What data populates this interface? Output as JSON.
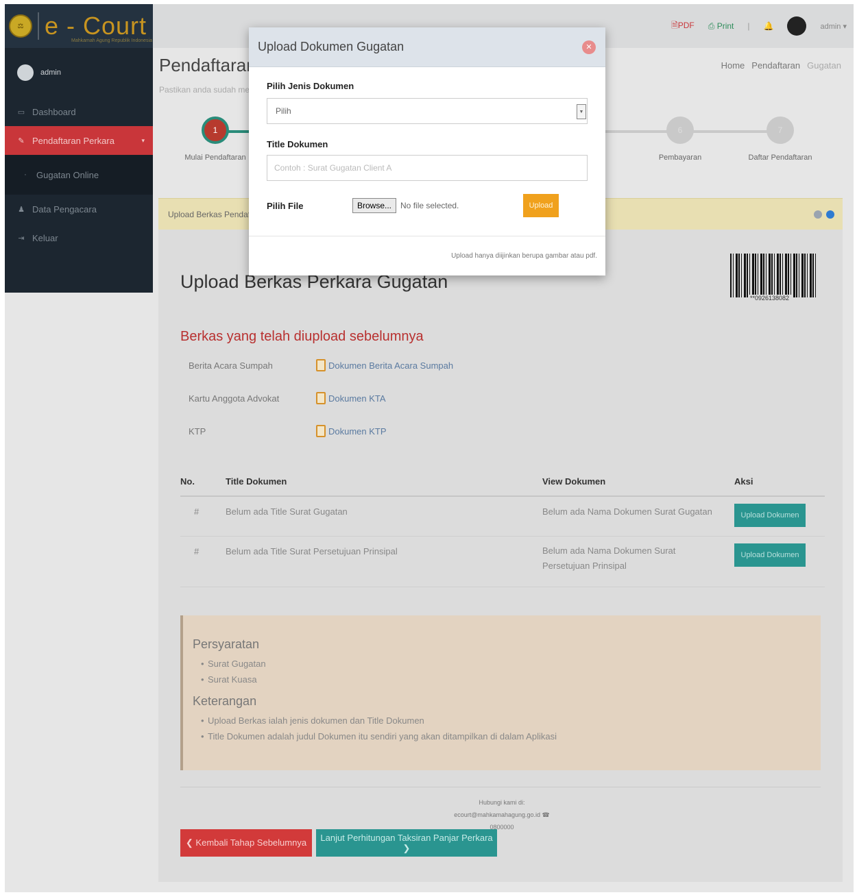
{
  "app": {
    "logo_text": "e - Court",
    "logo_sub": "Mahkamah Agung Republik Indonesia",
    "user_short": "admin"
  },
  "sidebar": {
    "items": [
      {
        "label": "Dashboard",
        "icon": "monitor-icon"
      },
      {
        "label": "Pendaftaran Perkara",
        "icon": "edit-icon"
      },
      {
        "label": "Gugatan Online",
        "icon": "dot-icon"
      },
      {
        "label": "Data Pengacara",
        "icon": "user-icon"
      },
      {
        "label": "Keluar",
        "icon": "logout-icon"
      }
    ]
  },
  "topbar": {
    "pdf": "PDF",
    "print": "Print",
    "sep": "|",
    "user": "admin"
  },
  "header": {
    "title": "Pendaftaran Gugatan",
    "subtitle": "Pastikan anda sudah mengisi data dengan benar",
    "breadcrumb": [
      "Home",
      "Pendaftaran",
      "Gugatan"
    ]
  },
  "stepper": {
    "steps": [
      {
        "num": "1",
        "label": "Mulai Pendaftaran"
      },
      {
        "num": "6",
        "label": "Pembayaran"
      },
      {
        "num": "7",
        "label": "Daftar Pendaftaran"
      }
    ]
  },
  "panel": {
    "header": "Upload Berkas Pendaftaran",
    "title": "Upload Berkas Perkara Gugatan",
    "barcode": "**0926138082"
  },
  "previous": {
    "title": "Berkas yang telah diupload sebelumnya",
    "rows": [
      {
        "label": "Berita Acara Sumpah",
        "link": "Dokumen Berita Acara Sumpah"
      },
      {
        "label": "Kartu Anggota Advokat",
        "link": "Dokumen KTA"
      },
      {
        "label": "KTP",
        "link": "Dokumen KTP"
      }
    ]
  },
  "table": {
    "headers": [
      "No.",
      "Title Dokumen",
      "View Dokumen",
      "Aksi"
    ],
    "rows": [
      {
        "no": "#",
        "title": "Belum ada Title Surat Gugatan",
        "view": "Belum ada Nama Dokumen Surat Gugatan",
        "action": "Upload Dokumen"
      },
      {
        "no": "#",
        "title": "Belum ada Title Surat Persetujuan Prinsipal",
        "view": "Belum ada Nama Dokumen Surat Persetujuan Prinsipal",
        "action": "Upload Dokumen"
      }
    ]
  },
  "requirements": {
    "title": "Persyaratan",
    "items": [
      "Surat Gugatan",
      "Surat Kuasa"
    ],
    "note_title": "Keterangan",
    "notes": [
      "Upload Berkas ialah jenis dokumen dan Title Dokumen",
      "Title Dokumen adalah judul Dokumen itu sendiri yang akan ditampilkan di dalam Aplikasi"
    ]
  },
  "footer": {
    "help_title": "Hubungi kami di:",
    "help_contact": "ecourt@mahkamahagung.go.id  ☎ 0800000"
  },
  "buttons": {
    "back": "❮ Kembali Tahap Sebelumnya",
    "next": "Lanjut Perhitungan Taksiran Panjar Perkara ❯"
  },
  "modal": {
    "title": "Upload Dokumen Gugatan",
    "jenis_label": "Pilih Jenis Dokumen",
    "jenis_value": "Pilih",
    "title_label": "Title Dokumen",
    "title_placeholder": "Contoh : Surat Gugatan Client A",
    "file_label": "Pilih File",
    "browse": "Browse...",
    "no_file": "No file selected.",
    "upload": "Upload",
    "footer_note": "Upload hanya diijinkan berupa gambar atau pdf."
  }
}
